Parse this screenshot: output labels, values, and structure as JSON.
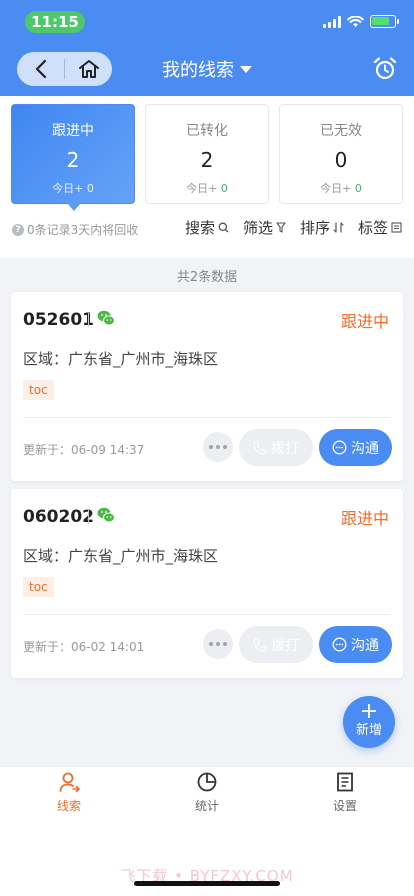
{
  "status_bar": {
    "time": "11:15"
  },
  "header": {
    "title": "我的线索",
    "back_icon": "chevron-left-icon",
    "home_icon": "home-icon",
    "alarm_icon": "alarm-clock-icon",
    "accent_color": "#4a8cf1"
  },
  "stats": [
    {
      "label": "跟进中",
      "count": "2",
      "today_prefix": "今日+ ",
      "today_value": "0",
      "active": true
    },
    {
      "label": "已转化",
      "count": "2",
      "today_prefix": "今日+ ",
      "today_value": "0",
      "active": false
    },
    {
      "label": "已无效",
      "count": "0",
      "today_prefix": "今日+ ",
      "today_value": "0",
      "active": false
    }
  ],
  "recycle_note": "0条记录3天内将回收",
  "tools": [
    {
      "label": "搜索",
      "icon": "search-icon"
    },
    {
      "label": "筛选",
      "icon": "filter-icon"
    },
    {
      "label": "排序",
      "icon": "sort-icon"
    },
    {
      "label": "标签",
      "icon": "tag-icon"
    }
  ],
  "count_line": "共2条数据",
  "leads": [
    {
      "id": "052601",
      "status": "跟进中",
      "region": "区域：广东省_广州市_海珠区",
      "tag": "toc",
      "updated": "更新于：06-09 14:37",
      "call_label": "拨打",
      "chat_label": "沟通"
    },
    {
      "id": "060202",
      "status": "跟进中",
      "region": "区域：广东省_广州市_海珠区",
      "tag": "toc",
      "updated": "更新于：06-02 14:01",
      "call_label": "拨打",
      "chat_label": "沟通"
    }
  ],
  "fab": {
    "label": "新增"
  },
  "bottom_nav": [
    {
      "label": "线索",
      "icon": "person-icon",
      "active": true
    },
    {
      "label": "统计",
      "icon": "pie-chart-icon",
      "active": false
    },
    {
      "label": "设置",
      "icon": "settings-icon",
      "active": false
    }
  ],
  "watermark": "飞下载 • BYFZXY.COM",
  "colors": {
    "primary": "#4a8cf1",
    "status_orange": "#ef6c2a",
    "today_green": "#3ab56a"
  }
}
